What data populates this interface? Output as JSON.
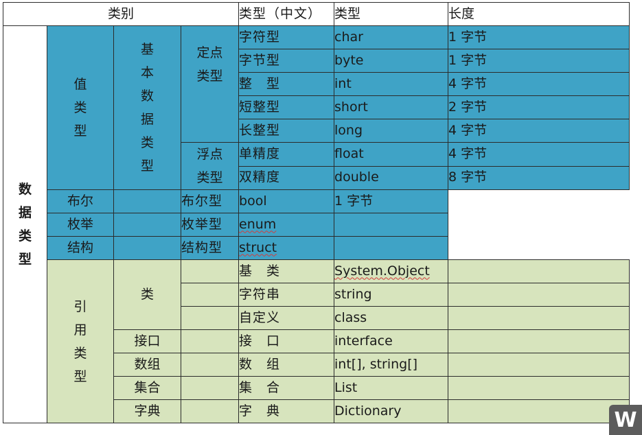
{
  "header": {
    "category": "类别",
    "type_cn": "类型（中文）",
    "type": "类型",
    "length": "长度"
  },
  "groups": {
    "data_types": [
      "数",
      "据",
      "类",
      "型"
    ],
    "value_types": [
      "值",
      "类",
      "型"
    ],
    "reference_types": [
      "引",
      "用",
      "类",
      "型"
    ],
    "basic_types": [
      "基",
      "本",
      "数",
      "据",
      "类",
      "型"
    ],
    "fixed_point": [
      "定点",
      "类型"
    ],
    "floating_point": [
      "浮点",
      "类型"
    ],
    "bool": "布尔",
    "enum": "枚举",
    "struct": "结构",
    "class": "类",
    "interface": "接口",
    "array": "数组",
    "collection": "集合",
    "dictionary": "字典"
  },
  "rows": [
    {
      "cn": "字符型",
      "type": "char",
      "len": "1 字节"
    },
    {
      "cn": "字节型",
      "type": "byte",
      "len": "1 字节"
    },
    {
      "cn": "整　型",
      "type": "int",
      "len": "4 字节"
    },
    {
      "cn": "短整型",
      "type": "short",
      "len": "2 字节"
    },
    {
      "cn": "长整型",
      "type": "long",
      "len": "4 字节"
    },
    {
      "cn": "单精度",
      "type": "float",
      "len": "4 字节"
    },
    {
      "cn": "双精度",
      "type": "double",
      "len": "8 字节"
    },
    {
      "cn": "布尔型",
      "type": "bool",
      "len": "1 字节"
    },
    {
      "cn": "枚举型",
      "type": "enum",
      "len": ""
    },
    {
      "cn": "结构型",
      "type": "struct",
      "len": ""
    },
    {
      "cn": "基　类",
      "type": "System.Object",
      "len": ""
    },
    {
      "cn": "字符串",
      "type": "string",
      "len": ""
    },
    {
      "cn": "自定义",
      "type": "class",
      "len": ""
    },
    {
      "cn": "接　口",
      "type": "interface",
      "len": ""
    },
    {
      "cn": "数　组",
      "type": "int[], string[]",
      "len": ""
    },
    {
      "cn": "集　合",
      "type": "List",
      "len": ""
    },
    {
      "cn": "字　典",
      "type": "Dictionary",
      "len": ""
    }
  ],
  "colors": {
    "value_bg": "#3fa3c6",
    "reference_bg": "#d7e4bd"
  },
  "watermark": "W"
}
